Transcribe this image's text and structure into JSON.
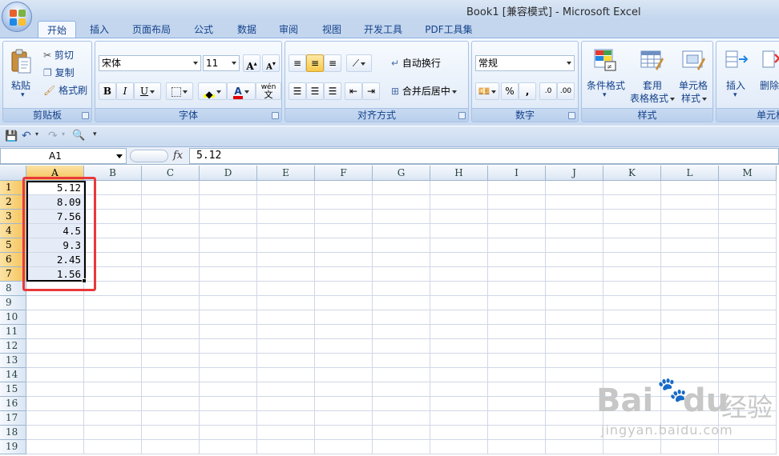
{
  "window": {
    "title": "Book1  [兼容模式] - Microsoft Excel"
  },
  "tabs": [
    "开始",
    "插入",
    "页面布局",
    "公式",
    "数据",
    "审阅",
    "视图",
    "开发工具",
    "PDF工具集"
  ],
  "ribbon": {
    "clipboard": {
      "label": "剪贴板",
      "paste": "粘贴",
      "cut": "剪切",
      "copy": "复制",
      "format_painter": "格式刷"
    },
    "font": {
      "label": "字体",
      "font_name": "宋体",
      "font_size": "11",
      "bold": "B",
      "italic": "I",
      "underline": "U",
      "font_color_glyph": "A",
      "phonetic_glyph": "wén",
      "phonetic_char": "文"
    },
    "alignment": {
      "label": "对齐方式",
      "wrap_text": "自动换行",
      "merge_center": "合并后居中"
    },
    "number": {
      "label": "数字",
      "format": "常规",
      "percent": "%",
      "comma": ","
    },
    "styles": {
      "label": "样式",
      "conditional_format": "条件格式",
      "table_format_1": "套用",
      "table_format_2": "表格格式",
      "cell_styles_1": "单元格",
      "cell_styles_2": "样式"
    },
    "cells": {
      "label": "单元格",
      "insert": "插入",
      "delete": "删除"
    }
  },
  "formula_bar": {
    "name_box": "A1",
    "fx": "fx",
    "value": "5.12"
  },
  "sheet": {
    "columns": [
      "A",
      "B",
      "C",
      "D",
      "E",
      "F",
      "G",
      "H",
      "I",
      "J",
      "K",
      "L",
      "M"
    ],
    "rows": [
      "1",
      "2",
      "3",
      "4",
      "5",
      "6",
      "7",
      "8",
      "9",
      "10",
      "11",
      "12",
      "13",
      "14",
      "15",
      "16",
      "17",
      "18",
      "19"
    ],
    "column_a_values": [
      "5.12",
      "8.09",
      "7.56",
      "4.5",
      "9.3",
      "2.45",
      "1.56"
    ]
  },
  "watermark": {
    "brand": "Bai",
    "brand2": "du",
    "jingyan": "经验",
    "url": "jingyan.baidu.com"
  },
  "colors": {
    "selection_red": "#e8393b",
    "ribbon_text": "#15428b"
  }
}
